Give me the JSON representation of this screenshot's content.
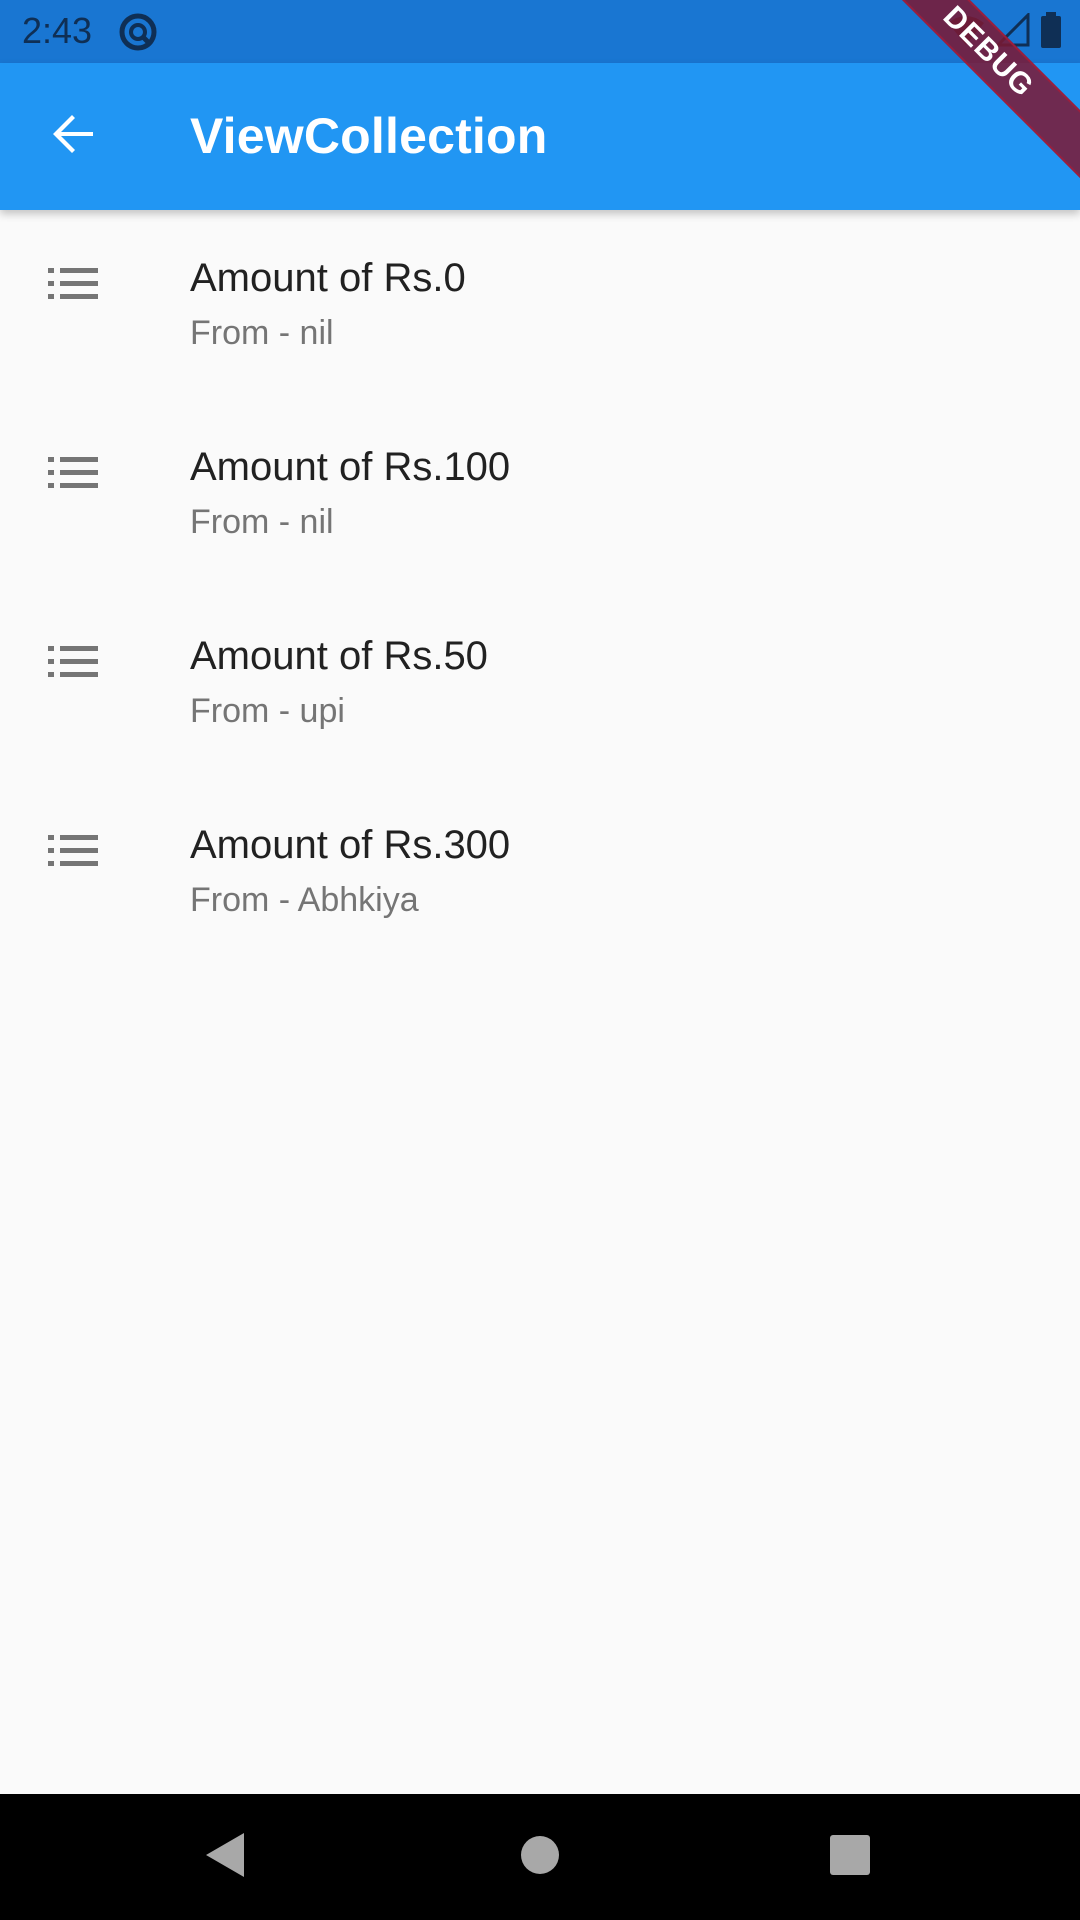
{
  "status_bar": {
    "time": "2:43",
    "icons": [
      "app-notification-icon",
      "wifi-icon",
      "cell-signal-icon",
      "battery-icon"
    ]
  },
  "app_bar": {
    "title": "ViewCollection",
    "back_icon": "arrow-back-icon",
    "background": "#2196f3"
  },
  "debug_banner": "DEBUG",
  "collections": [
    {
      "title": "Amount of Rs.0",
      "subtitle": "From - nil",
      "icon": "list-icon"
    },
    {
      "title": "Amount of Rs.100",
      "subtitle": "From - nil",
      "icon": "list-icon"
    },
    {
      "title": "Amount of Rs.50",
      "subtitle": "From - upi",
      "icon": "list-icon"
    },
    {
      "title": "Amount of Rs.300",
      "subtitle": "From - Abhkiya",
      "icon": "list-icon"
    }
  ],
  "nav_bar": {
    "buttons": [
      "back-triangle-icon",
      "home-circle-icon",
      "recents-square-icon"
    ]
  }
}
